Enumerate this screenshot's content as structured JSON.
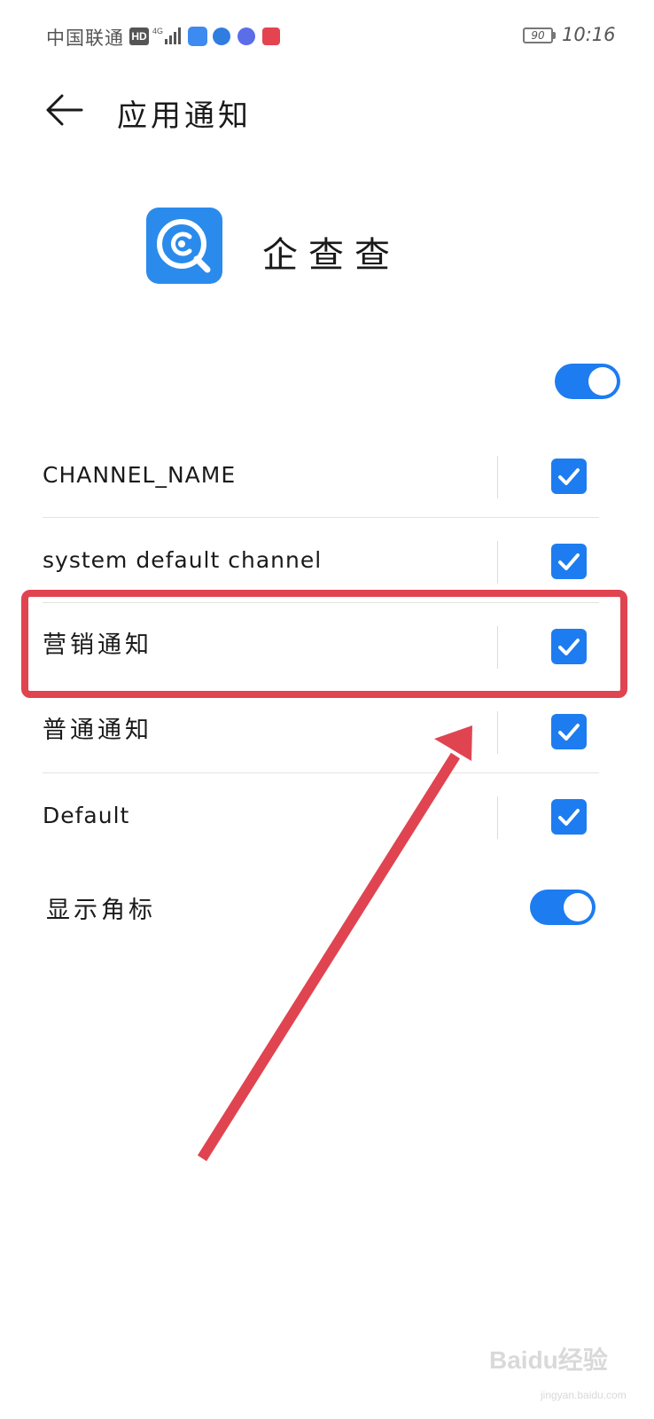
{
  "status_bar": {
    "carrier": "中国联通",
    "hd": "HD",
    "battery": "90",
    "time": "10:16"
  },
  "header": {
    "title": "应用通知"
  },
  "app": {
    "name": "企查查"
  },
  "master_toggle": {
    "on": true
  },
  "channels": [
    {
      "label": "CHANNEL_NAME",
      "checked": true
    },
    {
      "label": "system default channel",
      "checked": true
    },
    {
      "label": "营销通知",
      "checked": true
    },
    {
      "label": "普通通知",
      "checked": true
    },
    {
      "label": "Default",
      "checked": true
    }
  ],
  "badge": {
    "label": "显示角标",
    "on": true
  },
  "colors": {
    "accent": "#1d7cf0",
    "annotation": "#e04450"
  },
  "watermark": {
    "text": "Baidu经验",
    "sub": "jingyan.baidu.com"
  }
}
